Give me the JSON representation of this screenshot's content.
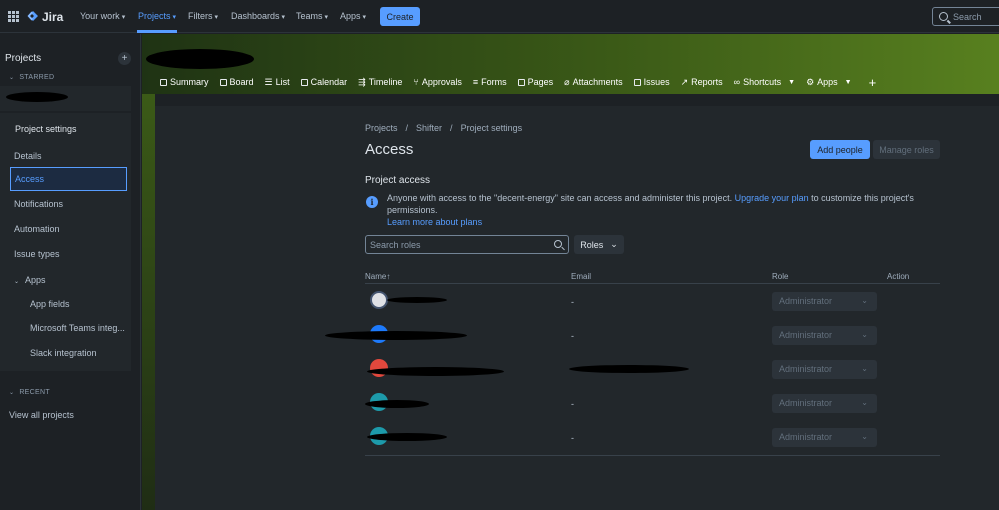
{
  "topnav": {
    "logo_text": "Jira",
    "items": [
      {
        "label": "Your work",
        "has_menu": true
      },
      {
        "label": "Projects",
        "has_menu": true,
        "active": true
      },
      {
        "label": "Filters",
        "has_menu": true
      },
      {
        "label": "Dashboards",
        "has_menu": true
      },
      {
        "label": "Teams",
        "has_menu": true
      },
      {
        "label": "Apps",
        "has_menu": true
      }
    ],
    "create_label": "Create",
    "search_placeholder": "Search"
  },
  "sidebar": {
    "title": "Projects",
    "starred_label": "STARRED",
    "settings_title": "Project settings",
    "items": [
      {
        "label": "Details"
      },
      {
        "label": "Access",
        "selected": true
      },
      {
        "label": "Notifications"
      },
      {
        "label": "Automation"
      },
      {
        "label": "Issue types"
      },
      {
        "label": "Apps",
        "expandable": true
      },
      {
        "label": "App fields",
        "sub": true
      },
      {
        "label": "Microsoft Teams integ...",
        "sub": true
      },
      {
        "label": "Slack integration",
        "sub": true
      }
    ],
    "recent_label": "RECENT",
    "view_all_label": "View all projects"
  },
  "project_tabs": [
    {
      "label": "Summary"
    },
    {
      "label": "Board"
    },
    {
      "label": "List"
    },
    {
      "label": "Calendar"
    },
    {
      "label": "Timeline"
    },
    {
      "label": "Approvals"
    },
    {
      "label": "Forms"
    },
    {
      "label": "Pages"
    },
    {
      "label": "Attachments"
    },
    {
      "label": "Issues"
    },
    {
      "label": "Reports"
    },
    {
      "label": "Shortcuts",
      "has_menu": true
    },
    {
      "label": "Apps",
      "has_menu": true
    }
  ],
  "breadcrumb": [
    "Projects",
    "/",
    "Shifter",
    "/",
    "Project settings"
  ],
  "page": {
    "title": "Access",
    "add_people_label": "Add people",
    "manage_roles_label": "Manage roles",
    "project_access_title": "Project access",
    "info_text_1": "Anyone with access to the \"decent-energy\" site can access and administer this project.",
    "info_link_1": "Upgrade your plan",
    "info_text_2": "to customize this project's permissions.",
    "info_link_2": "Learn more about plans",
    "search_roles_placeholder": "Search roles",
    "roles_filter_label": "Roles"
  },
  "table": {
    "headers": {
      "name": "Name",
      "email": "Email",
      "role": "Role",
      "action": "Action"
    },
    "rows": [
      {
        "email": "-",
        "role": "Administrator",
        "avatar_color": "#dfe1e6"
      },
      {
        "email": "-",
        "role": "Administrator",
        "avatar_color": "#1d7afc"
      },
      {
        "email": "",
        "role": "Administrator",
        "avatar_color": "#e2483d"
      },
      {
        "email": "-",
        "role": "Administrator",
        "avatar_color": "#1d9aaa"
      },
      {
        "email": "-",
        "role": "Administrator",
        "avatar_color": "#1d9aaa"
      }
    ]
  },
  "colors": {
    "accent": "#579dff",
    "banner_green": "#58801f",
    "background": "#1d2125"
  }
}
